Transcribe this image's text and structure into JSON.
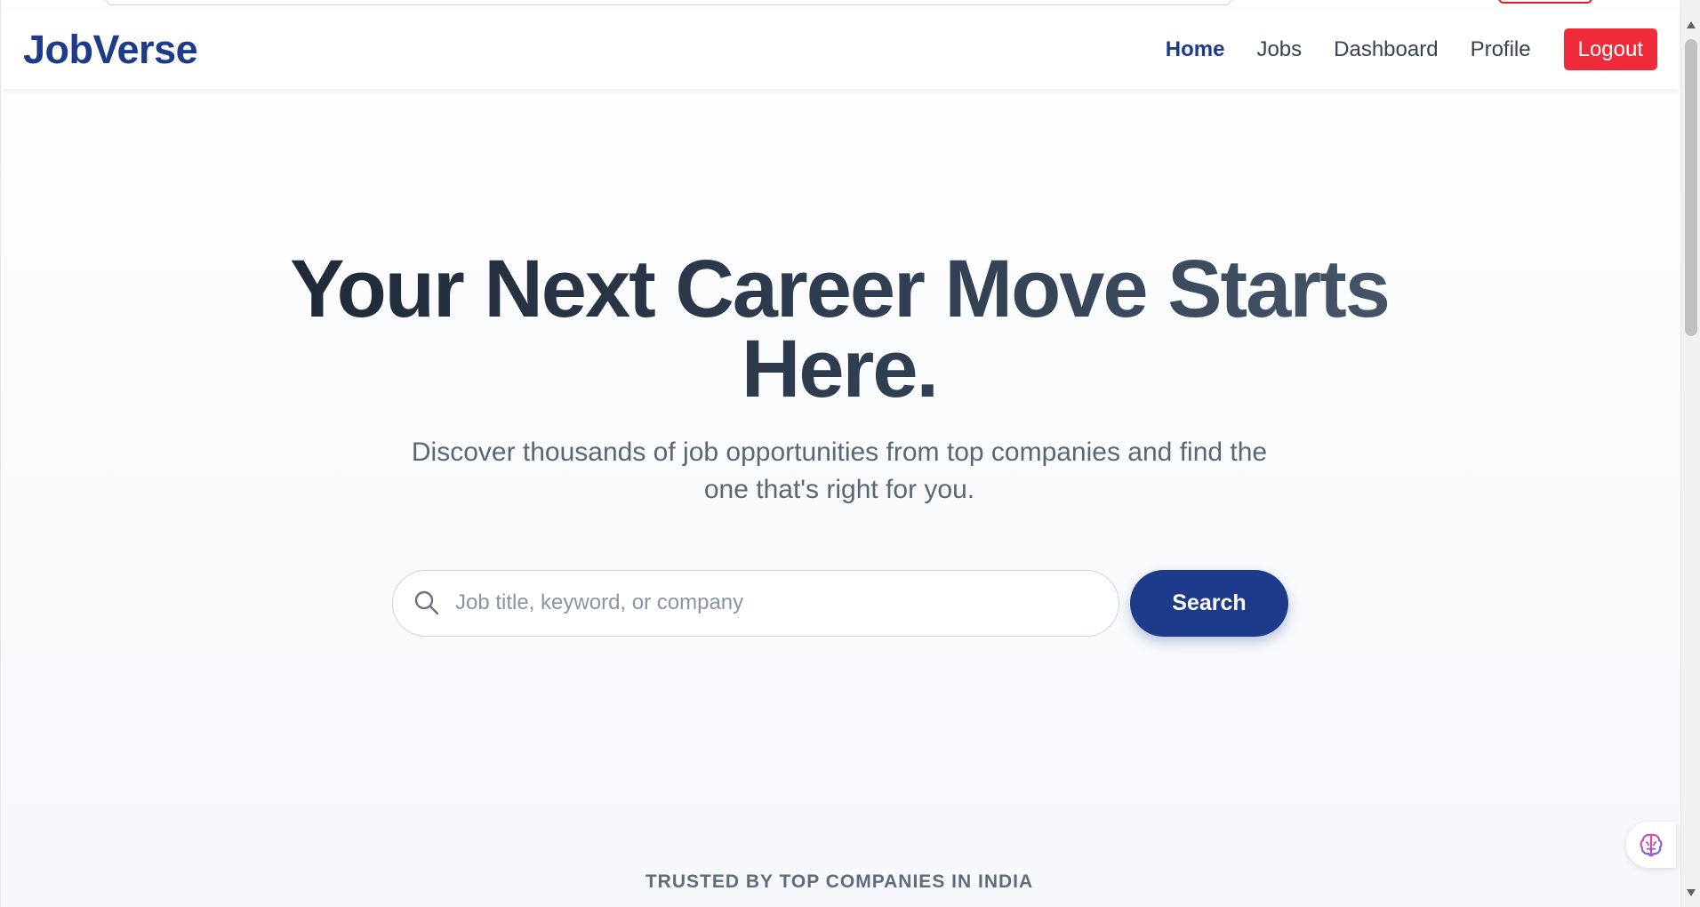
{
  "app": {
    "logo": "JobVerse"
  },
  "nav": {
    "items": [
      {
        "label": "Home",
        "active": true
      },
      {
        "label": "Jobs",
        "active": false
      },
      {
        "label": "Dashboard",
        "active": false
      },
      {
        "label": "Profile",
        "active": false
      }
    ],
    "logout_label": "Logout"
  },
  "hero": {
    "title": "Your Next Career Move Starts Here.",
    "subtitle": "Discover thousands of job opportunities from top companies and find the one that's right for you."
  },
  "search": {
    "placeholder": "Job title, keyword, or company",
    "value": "",
    "button_label": "Search"
  },
  "trusted": {
    "label": "TRUSTED BY TOP COMPANIES IN INDIA"
  },
  "icons": {
    "search": "search-icon",
    "ai_widget": "brain-icon",
    "scroll_up": "chevron-up-icon",
    "scroll_down": "chevron-down-icon"
  },
  "colors": {
    "brand": "#1e3a8a",
    "logout": "#ef2b3a",
    "text_dark": "#1f2937",
    "text_muted": "#5b6575"
  }
}
